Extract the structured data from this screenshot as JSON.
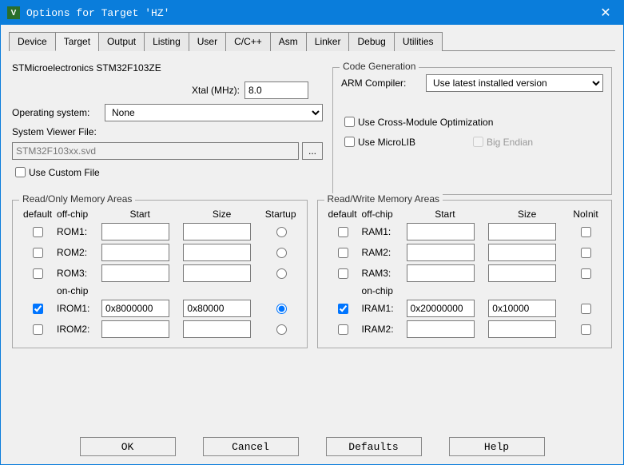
{
  "window": {
    "title": "Options for Target 'HZ'"
  },
  "tabs": {
    "items": [
      "Device",
      "Target",
      "Output",
      "Listing",
      "User",
      "C/C++",
      "Asm",
      "Linker",
      "Debug",
      "Utilities"
    ],
    "active": "Target"
  },
  "target": {
    "mcu": "STMicroelectronics STM32F103ZE",
    "xtal_label": "Xtal (MHz):",
    "xtal": "8.0",
    "os_label": "Operating system:",
    "os": "None",
    "svd_label": "System Viewer File:",
    "svd": "STM32F103xx.svd",
    "use_custom_label": "Use Custom File",
    "use_custom": false
  },
  "codegen": {
    "legend": "Code Generation",
    "compiler_label": "ARM Compiler:",
    "compiler": "Use latest installed version",
    "cross_label": "Use Cross-Module Optimization",
    "cross": false,
    "microlib_label": "Use MicroLIB",
    "microlib": false,
    "bigendian_label": "Big Endian",
    "bigendian": false
  },
  "ro": {
    "legend": "Read/Only Memory Areas",
    "cols": {
      "default": "default",
      "offchip": "off-chip",
      "start": "Start",
      "size": "Size",
      "startup": "Startup",
      "onchip": "on-chip"
    },
    "rows": [
      {
        "name": "ROM1:",
        "def": false,
        "start": "",
        "size": "",
        "startup": false
      },
      {
        "name": "ROM2:",
        "def": false,
        "start": "",
        "size": "",
        "startup": false
      },
      {
        "name": "ROM3:",
        "def": false,
        "start": "",
        "size": "",
        "startup": false
      }
    ],
    "onchip": [
      {
        "name": "IROM1:",
        "def": true,
        "start": "0x8000000",
        "size": "0x80000",
        "startup": true
      },
      {
        "name": "IROM2:",
        "def": false,
        "start": "",
        "size": "",
        "startup": false
      }
    ]
  },
  "rw": {
    "legend": "Read/Write Memory Areas",
    "cols": {
      "default": "default",
      "offchip": "off-chip",
      "start": "Start",
      "size": "Size",
      "noinit": "NoInit",
      "onchip": "on-chip"
    },
    "rows": [
      {
        "name": "RAM1:",
        "def": false,
        "start": "",
        "size": "",
        "noinit": false
      },
      {
        "name": "RAM2:",
        "def": false,
        "start": "",
        "size": "",
        "noinit": false
      },
      {
        "name": "RAM3:",
        "def": false,
        "start": "",
        "size": "",
        "noinit": false
      }
    ],
    "onchip": [
      {
        "name": "IRAM1:",
        "def": true,
        "start": "0x20000000",
        "size": "0x10000",
        "noinit": false
      },
      {
        "name": "IRAM2:",
        "def": false,
        "start": "",
        "size": "",
        "noinit": false
      }
    ]
  },
  "buttons": {
    "ok": "OK",
    "cancel": "Cancel",
    "defaults": "Defaults",
    "help": "Help"
  }
}
